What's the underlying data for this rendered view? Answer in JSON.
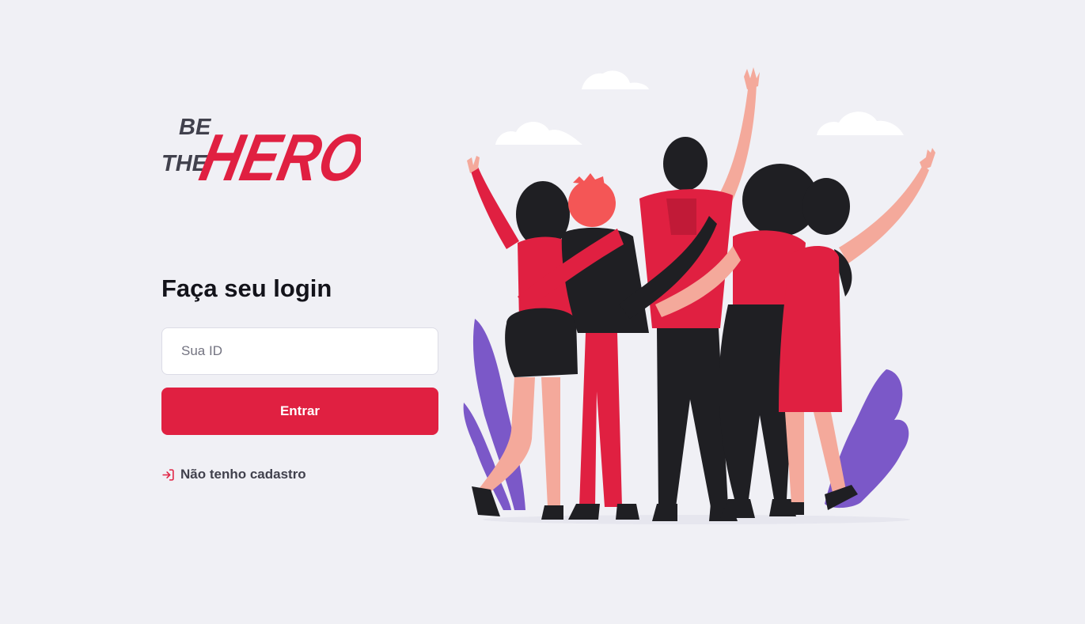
{
  "logo": {
    "line1": "BE",
    "line2": "THE",
    "line3": "HERO",
    "brand_color": "#E02041",
    "dark_color": "#41414D"
  },
  "login": {
    "title": "Faça seu login",
    "id_input": {
      "placeholder": "Sua ID",
      "value": ""
    },
    "submit_label": "Entrar",
    "register_link": {
      "icon": "log-in-icon",
      "label": "Não tenho cadastro"
    }
  },
  "colors": {
    "background": "#F0F0F5",
    "accent": "#E02041",
    "text_dark": "#13131A",
    "text_medium": "#41414D"
  }
}
